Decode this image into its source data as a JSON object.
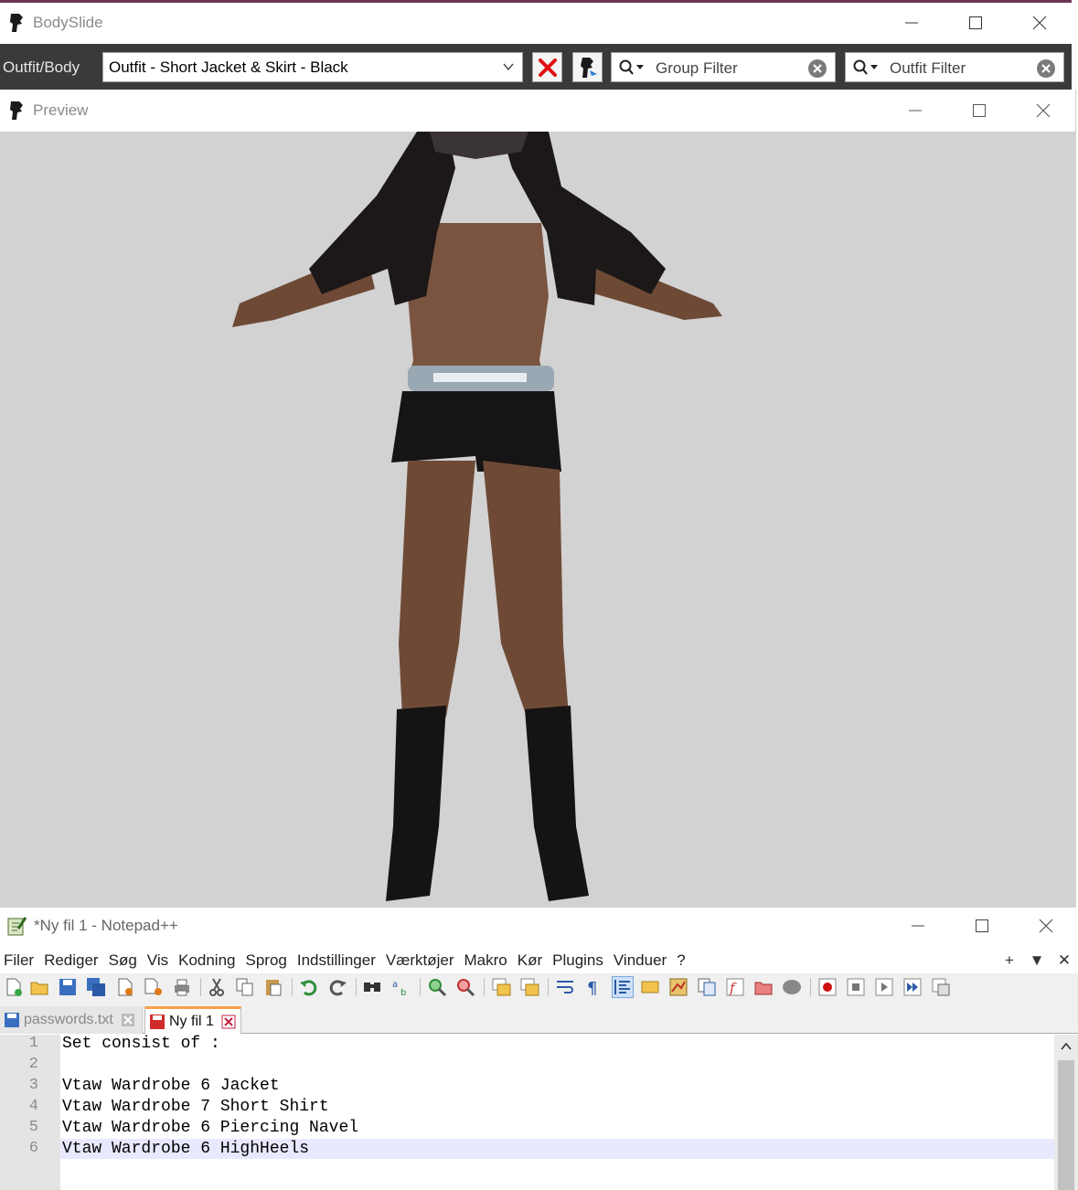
{
  "bodyslide": {
    "title": "BodySlide",
    "toolbar": {
      "label": "Outfit/Body",
      "outfit_value": "Outfit - Short Jacket & Skirt - Black",
      "group_filter_placeholder": "Group Filter",
      "outfit_filter_placeholder": "Outfit Filter"
    }
  },
  "preview": {
    "title": "Preview",
    "viewport_background": "#d2d2d2"
  },
  "notepad": {
    "title": "*Ny fil 1 - Notepad++",
    "menu": [
      "Filer",
      "Rediger",
      "Søg",
      "Vis",
      "Kodning",
      "Sprog",
      "Indstillinger",
      "Værktøjer",
      "Makro",
      "Kør",
      "Plugins",
      "Vinduer",
      "?"
    ],
    "menu_right": [
      "+",
      "▼",
      "✕"
    ],
    "tabs": [
      {
        "label": "passwords.txt",
        "active": false
      },
      {
        "label": "Ny fil 1",
        "active": true
      }
    ],
    "line_numbers": [
      "1",
      "2",
      "3",
      "4",
      "5",
      "6"
    ],
    "lines": [
      "Set consist of :",
      "",
      "Vtaw Wardrobe 6 Jacket",
      "Vtaw Wardrobe 7 Short Shirt",
      "Vtaw Wardrobe 6 Piercing Navel",
      "Vtaw Wardrobe 6 HighHeels"
    ],
    "current_line": 6
  },
  "colors": {
    "toolbar_bg": "#3a3a3a",
    "title_accent": "#6c3450",
    "tab_active_accent": "#f7a14a",
    "current_line_bg": "#e8e8ff"
  }
}
